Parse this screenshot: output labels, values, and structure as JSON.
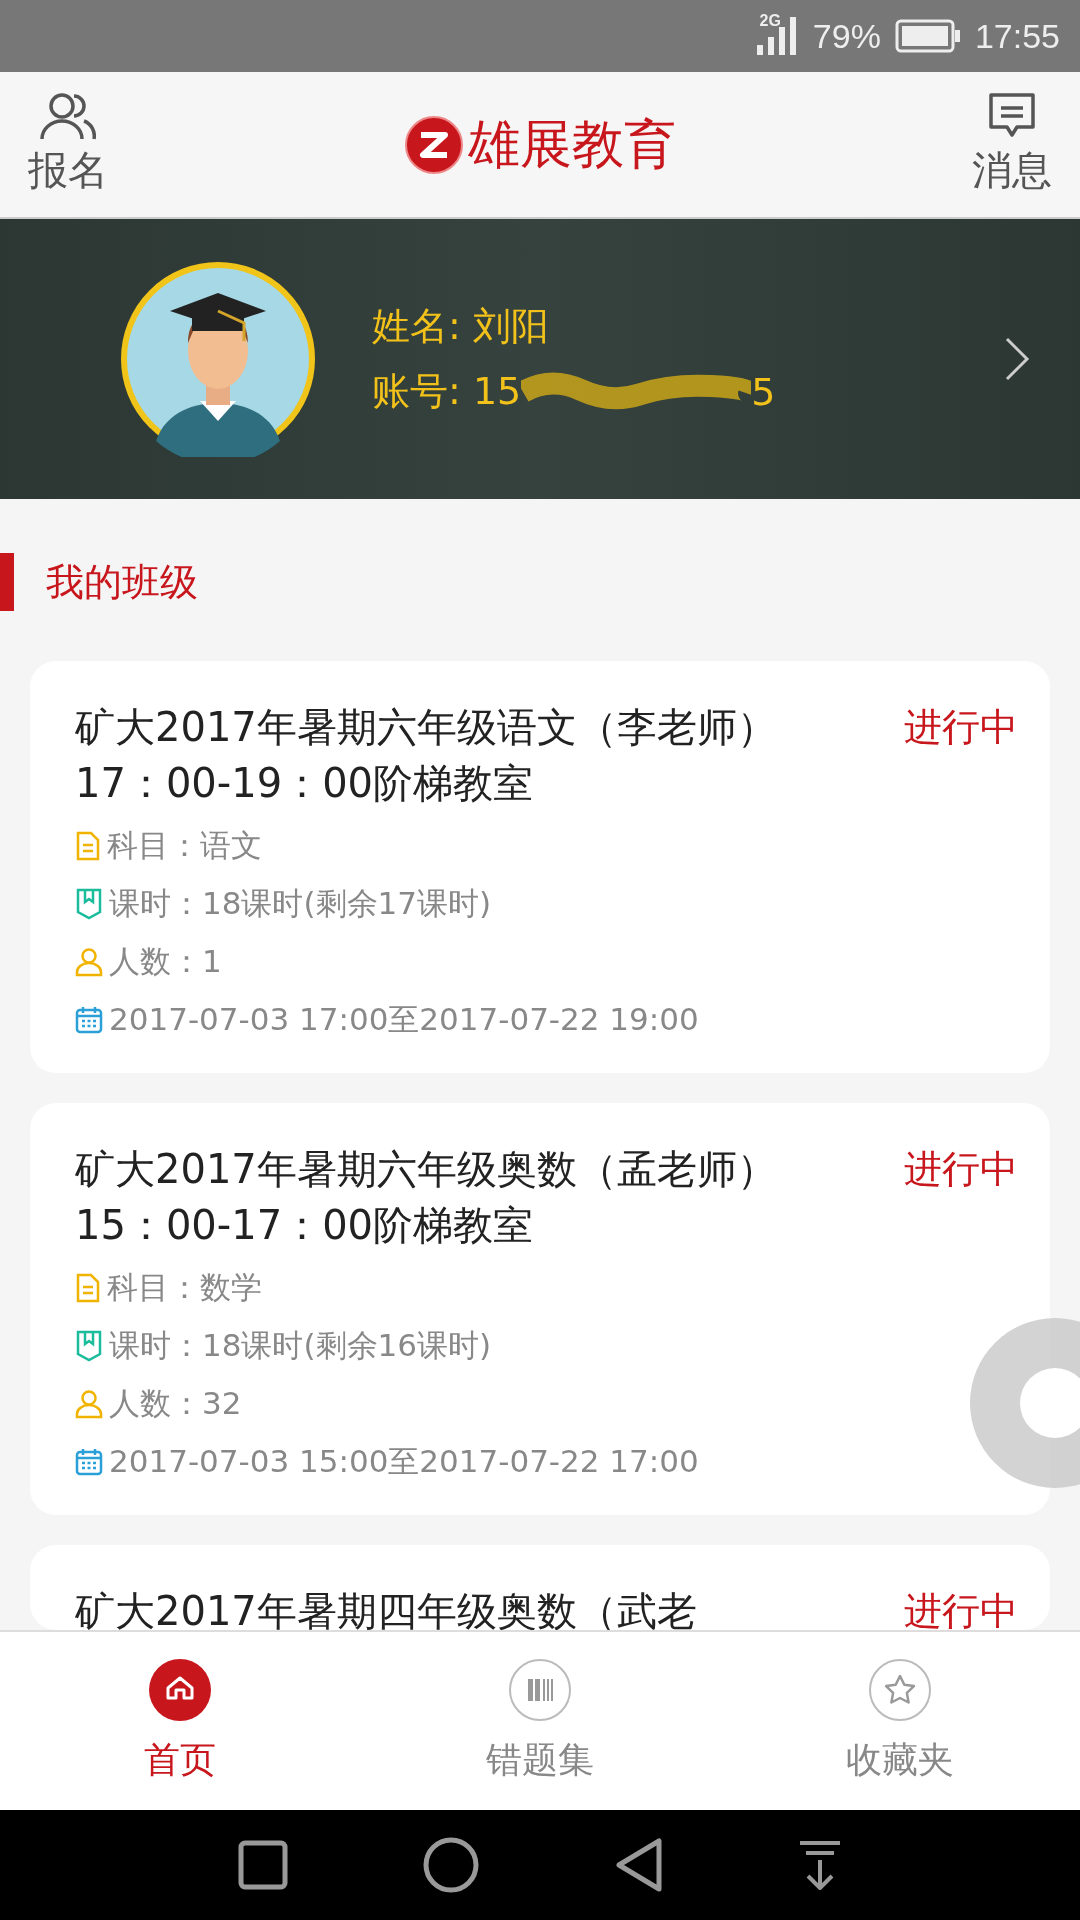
{
  "status_bar": {
    "network": "2G",
    "battery": "79%",
    "time": "17:55"
  },
  "header": {
    "left": "报名",
    "title": "雄展教育",
    "right": "消息"
  },
  "profile": {
    "name": "姓名: 刘阳",
    "account_prefix": "账号: 15",
    "account_suffix": "5"
  },
  "section_title": "我的班级",
  "classes": [
    {
      "title": "矿大2017年暑期六年级语文（李老师）17：00-19：00阶梯教室",
      "status": "进行中",
      "subject": "科目：语文",
      "hours": "课时：18课时(剩余17课时)",
      "people": "人数：1",
      "dates": "2017-07-03 17:00至2017-07-22 19:00"
    },
    {
      "title": "矿大2017年暑期六年级奥数（孟老师）15：00-17：00阶梯教室",
      "status": "进行中",
      "subject": "科目：数学",
      "hours": "课时：18课时(剩余16课时)",
      "people": "人数：32",
      "dates": "2017-07-03 15:00至2017-07-22 17:00"
    },
    {
      "title": "矿大2017年暑期四年级奥数（武老",
      "status": "进行中"
    }
  ],
  "tabs": [
    {
      "label": "首页",
      "kind": "home",
      "selected": true
    },
    {
      "label": "错题集",
      "kind": "books",
      "selected": false
    },
    {
      "label": "收藏夹",
      "kind": "star",
      "selected": false
    }
  ]
}
